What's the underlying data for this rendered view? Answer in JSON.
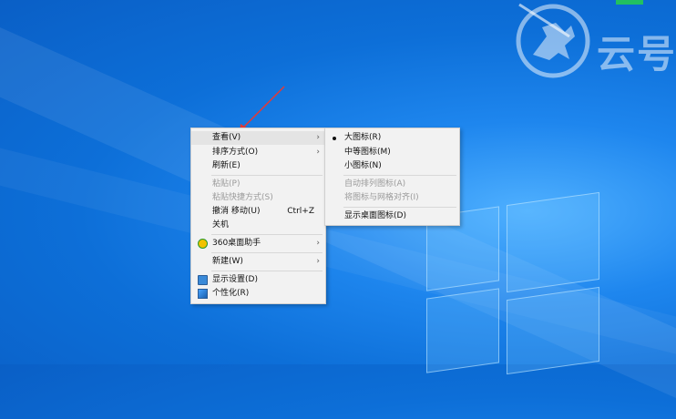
{
  "watermark": {
    "text": "云号"
  },
  "context_menu": {
    "items": [
      {
        "label": "查看(V)",
        "submenu": true,
        "hover": true
      },
      {
        "label": "排序方式(O)",
        "submenu": true
      },
      {
        "label": "刷新(E)"
      },
      {
        "label": "粘贴(P)",
        "disabled": true
      },
      {
        "label": "粘贴快捷方式(S)",
        "disabled": true
      },
      {
        "label": "撤消 移动(U)",
        "shortcut": "Ctrl+Z"
      },
      {
        "label": "关机"
      },
      {
        "label": "360桌面助手",
        "submenu": true,
        "icon": "360-icon"
      },
      {
        "label": "新建(W)",
        "submenu": true
      },
      {
        "label": "显示设置(D)",
        "icon": "display-settings-icon"
      },
      {
        "label": "个性化(R)",
        "icon": "personalize-icon"
      }
    ]
  },
  "view_submenu": {
    "items": [
      {
        "label": "大图标(R)",
        "selected": true
      },
      {
        "label": "中等图标(M)"
      },
      {
        "label": "小图标(N)"
      },
      {
        "label": "自动排列图标(A)",
        "disabled": true
      },
      {
        "label": "将图标与网格对齐(I)",
        "disabled": true
      },
      {
        "label": "显示桌面图标(D)"
      }
    ]
  },
  "colors": {
    "desktop_blue": "#0d6fd8",
    "menu_bg": "#f2f2f2",
    "annotation_arrow": "#e53935"
  }
}
